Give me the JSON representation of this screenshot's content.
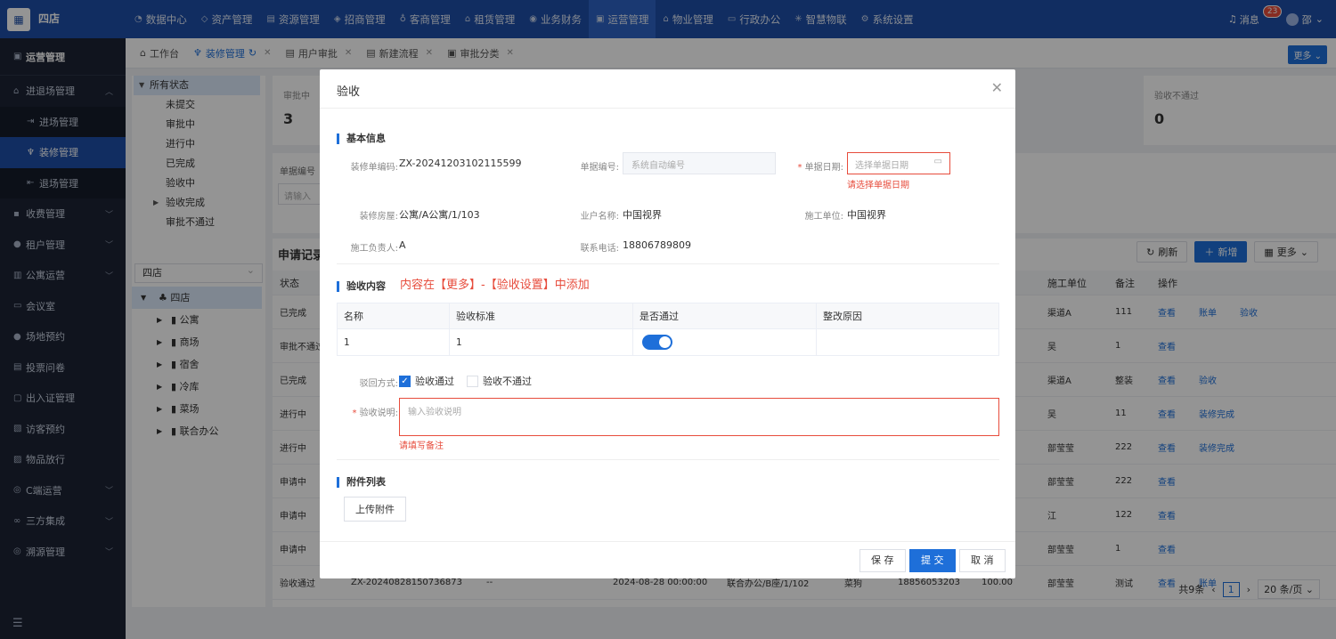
{
  "app": {
    "brand": "四店",
    "logo_icon": "building-icon"
  },
  "nav": [
    {
      "label": "数据中心",
      "icon": "dashboard-icon"
    },
    {
      "label": "资产管理",
      "icon": "cube-icon"
    },
    {
      "label": "资源管理",
      "icon": "document-icon"
    },
    {
      "label": "招商管理",
      "icon": "tag-icon"
    },
    {
      "label": "客商管理",
      "icon": "users-icon"
    },
    {
      "label": "租赁管理",
      "icon": "home-icon"
    },
    {
      "label": "业务财务",
      "icon": "coin-icon"
    },
    {
      "label": "运营管理",
      "icon": "grid-icon",
      "active": true
    },
    {
      "label": "物业管理",
      "icon": "building-icon"
    },
    {
      "label": "行政办公",
      "icon": "monitor-icon"
    },
    {
      "label": "智慧物联",
      "icon": "iot-icon"
    },
    {
      "label": "系统设置",
      "icon": "gear-icon"
    }
  ],
  "top_right": {
    "message_label": "消息",
    "message_count": "23",
    "user_name": "邵"
  },
  "sidebar": {
    "title": "运营管理",
    "items": [
      {
        "label": "进退场管理",
        "icon": "home-icon",
        "expandable": true,
        "expanded": true
      },
      {
        "label": "进场管理",
        "icon": "login-icon",
        "sub": true
      },
      {
        "label": "装修管理",
        "icon": "brush-icon",
        "sub": true,
        "active": true
      },
      {
        "label": "退场管理",
        "icon": "logout-icon",
        "sub": true
      },
      {
        "label": "收费管理",
        "icon": "wallet-icon",
        "expandable": true
      },
      {
        "label": "租户管理",
        "icon": "user-icon",
        "expandable": true
      },
      {
        "label": "公寓运营",
        "icon": "apartment-icon",
        "expandable": true
      },
      {
        "label": "会议室",
        "icon": "meeting-icon"
      },
      {
        "label": "场地预约",
        "icon": "person-icon"
      },
      {
        "label": "投票问卷",
        "icon": "survey-icon"
      },
      {
        "label": "出入证管理",
        "icon": "card-icon"
      },
      {
        "label": "访客预约",
        "icon": "visitor-icon"
      },
      {
        "label": "物品放行",
        "icon": "box-icon"
      },
      {
        "label": "C端运营",
        "icon": "settings-icon",
        "expandable": true
      },
      {
        "label": "三方集成",
        "icon": "link-icon",
        "expandable": true
      },
      {
        "label": "溯源管理",
        "icon": "trace-icon",
        "expandable": true
      }
    ]
  },
  "tabs": [
    {
      "label": "工作台",
      "icon": "home-icon",
      "closable": false
    },
    {
      "label": "装修管理",
      "icon": "brush-icon",
      "closable": true,
      "active": true,
      "refresh": true
    },
    {
      "label": "用户审批",
      "icon": "document-icon",
      "closable": true
    },
    {
      "label": "新建流程",
      "icon": "document-icon",
      "closable": true
    },
    {
      "label": "审批分类",
      "icon": "grid-icon",
      "closable": true
    }
  ],
  "tabs_more": "更多",
  "status_tree": {
    "root": "所有状态",
    "items": [
      "未提交",
      "审批中",
      "进行中",
      "已完成",
      "验收中",
      "验收完成",
      "审批不通过"
    ]
  },
  "location_tree": {
    "select": "四店",
    "root": "四店",
    "items": [
      "公寓",
      "商场",
      "宿舍",
      "冷库",
      "菜场",
      "联合办公"
    ]
  },
  "stats": [
    {
      "label": "审批中",
      "value": "3"
    },
    {
      "label": "验收不通过",
      "value": "0"
    }
  ],
  "filter": {
    "label": "单据编号",
    "placeholder": "请输入"
  },
  "list": {
    "title": "申请记录",
    "refresh": "刷新",
    "add": "新增",
    "more": "更多",
    "columns": {
      "status": "状态",
      "builder": "施工单位",
      "note": "备注",
      "ops": "操作"
    },
    "rows": [
      {
        "status": "已完成",
        "builder": "渠道A",
        "note": "111",
        "ops": [
          "查看",
          "账单",
          "验收"
        ]
      },
      {
        "status": "审批不通过",
        "builder": "吴",
        "note": "1",
        "ops": [
          "查看"
        ]
      },
      {
        "status": "已完成",
        "builder": "渠道A",
        "note": "整装",
        "ops": [
          "查看",
          "验收"
        ]
      },
      {
        "status": "进行中",
        "builder": "吴",
        "note": "11",
        "ops": [
          "查看",
          "装修完成"
        ]
      },
      {
        "status": "进行中",
        "builder": "部莹莹",
        "note": "222",
        "ops": [
          "查看",
          "装修完成"
        ]
      },
      {
        "status": "申请中",
        "builder": "部莹莹",
        "note": "222",
        "ops": [
          "查看"
        ]
      },
      {
        "status": "申请中",
        "builder": "江",
        "note": "122",
        "ops": [
          "查看"
        ]
      },
      {
        "status": "申请中",
        "builder": "部莹莹",
        "note": "1",
        "ops": [
          "查看"
        ]
      },
      {
        "status": "验收通过",
        "code": "ZX-20240828150736873",
        "dash": "--",
        "date": "2024-08-28 00:00:00",
        "room": "联合办公/B座/1/102",
        "person": "菜狗",
        "phone": "18856053203",
        "amount": "100.00",
        "builder": "部莹莹",
        "note": "测试",
        "ops": [
          "查看",
          "账单"
        ]
      }
    ],
    "pager": {
      "total": "共9条",
      "page": "1",
      "size": "20 条/页"
    }
  },
  "modal": {
    "title": "验收",
    "basic_section": "基本信息",
    "fields": {
      "code_label": "装修单编码:",
      "code_value": "ZX-20241203102115599",
      "doc_no_label": "单据编号:",
      "doc_no_placeholder": "系统自动编号",
      "doc_date_label": "单据日期:",
      "doc_date_placeholder": "选择单据日期",
      "doc_date_error": "请选择单据日期",
      "room_label": "装修房屋:",
      "room_value": "公寓/A公寓/1/103",
      "owner_label": "业户名称:",
      "owner_value": "中国视界",
      "builder_label": "施工单位:",
      "builder_value": "中国视界",
      "leader_label": "施工负责人:",
      "leader_value": "A",
      "phone_label": "联系电话:",
      "phone_value": "18806789809"
    },
    "content_section": "验收内容",
    "content_hint": "内容在【更多】-【验收设置】中添加",
    "table": {
      "headers": [
        "名称",
        "验收标准",
        "是否通过",
        "整改原因"
      ],
      "rows": [
        {
          "name": "1",
          "standard": "1",
          "passed": true,
          "reason": ""
        }
      ]
    },
    "result": {
      "label": "驳回方式:",
      "pass": "验收通过",
      "fail": "验收不通过",
      "selected": "pass"
    },
    "desc": {
      "label": "验收说明:",
      "placeholder": "输入验收说明",
      "error": "请填写备注"
    },
    "attach_section": "附件列表",
    "upload": "上传附件",
    "buttons": {
      "save": "保 存",
      "submit": "提 交",
      "cancel": "取 消"
    }
  },
  "colors": {
    "primary": "#1e6fd9",
    "topbar": "#1e4fa8",
    "sidebar": "#1c2435",
    "error": "#e74c3c"
  }
}
